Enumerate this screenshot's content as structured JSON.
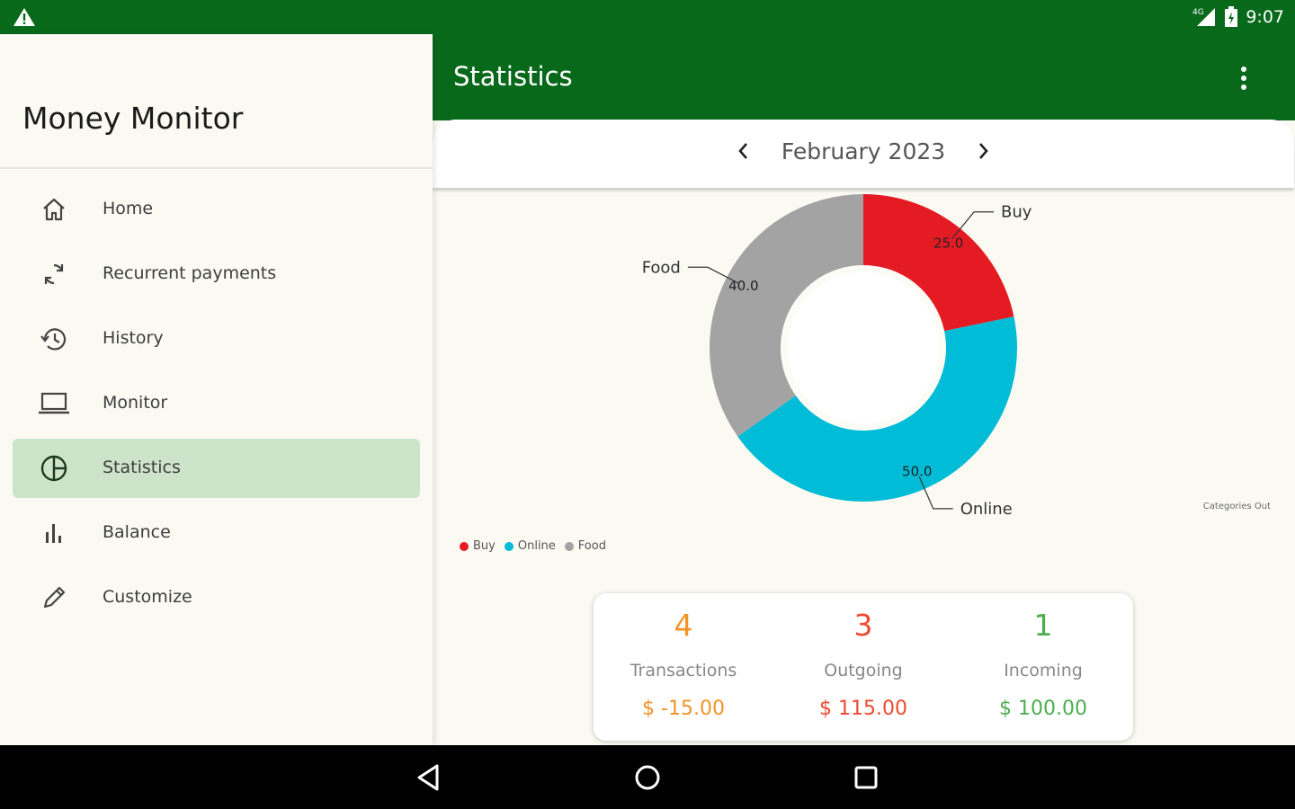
{
  "status_bar": {
    "time": "9:07",
    "network": "4G",
    "icons": [
      "warning-icon",
      "signal-icon",
      "battery-icon"
    ]
  },
  "drawer": {
    "title": "Money Monitor",
    "items": [
      {
        "label": "Home",
        "icon": "home-icon"
      },
      {
        "label": "Recurrent payments",
        "icon": "refresh-icon"
      },
      {
        "label": "History",
        "icon": "history-icon"
      },
      {
        "label": "Monitor",
        "icon": "laptop-icon"
      },
      {
        "label": "Statistics",
        "icon": "pie-chart-icon",
        "active": true
      },
      {
        "label": "Balance",
        "icon": "bar-chart-icon"
      },
      {
        "label": "Customize",
        "icon": "pencil-icon"
      }
    ]
  },
  "appbar": {
    "title": "Statistics",
    "menu_icon": "more-vert-icon"
  },
  "month_selector": {
    "label": "February 2023"
  },
  "chart_data": {
    "type": "pie",
    "categories": [
      "Buy",
      "Online",
      "Food"
    ],
    "values": [
      25.0,
      50.0,
      40.0
    ],
    "value_labels": [
      "25.0",
      "50.0",
      "40.0"
    ],
    "colors": [
      "#e51b23",
      "#00bcd6",
      "#a3a3a3"
    ],
    "description": "Categories Out",
    "legend": "bottom-left",
    "donut": true
  },
  "summary": [
    {
      "count": "4",
      "label": "Transactions",
      "amount": "$ -15.00",
      "color": "#f39327"
    },
    {
      "count": "3",
      "label": "Outgoing",
      "amount": "$ 115.00",
      "color": "#ee4a31"
    },
    {
      "count": "1",
      "label": "Incoming",
      "amount": "$ 100.00",
      "color": "#4cae4f"
    }
  ],
  "nav_bar": {
    "icons": [
      "back-icon",
      "home-circle-icon",
      "recents-icon"
    ]
  },
  "colors": {
    "primary": "#08691b",
    "drawer_active": "#cde4cb",
    "background": "#fafaf3"
  }
}
